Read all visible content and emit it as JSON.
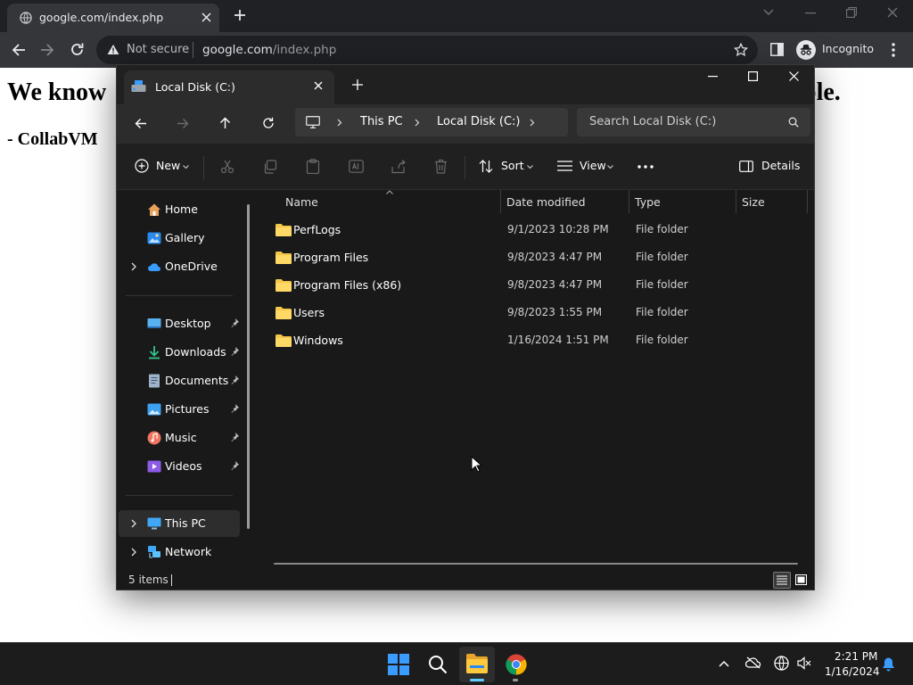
{
  "browser": {
    "tab_title": "google.com/index.php",
    "security_label": "Not secure",
    "url_host": "google.com",
    "url_path": "/index.php",
    "profile_label": "Incognito"
  },
  "page": {
    "heading_left": "We know",
    "heading_right": "ble.",
    "subheading": "- CollabVM"
  },
  "explorer": {
    "tab_title": "Local Disk (C:)",
    "breadcrumb": [
      "This PC",
      "Local Disk (C:)"
    ],
    "search_placeholder": "Search Local Disk (C:)",
    "toolbar": {
      "new_label": "New",
      "sort_label": "Sort",
      "view_label": "View",
      "details_label": "Details"
    },
    "nav": [
      {
        "label": "Home"
      },
      {
        "label": "Gallery"
      },
      {
        "label": "OneDrive"
      },
      {
        "label": "Desktop"
      },
      {
        "label": "Downloads"
      },
      {
        "label": "Documents"
      },
      {
        "label": "Pictures"
      },
      {
        "label": "Music"
      },
      {
        "label": "Videos"
      },
      {
        "label": "This PC"
      },
      {
        "label": "Network"
      }
    ],
    "columns": [
      "Name",
      "Date modified",
      "Type",
      "Size"
    ],
    "rows": [
      {
        "name": "PerfLogs",
        "date": "9/1/2023 10:28 PM",
        "type": "File folder"
      },
      {
        "name": "Program Files",
        "date": "9/8/2023 4:47 PM",
        "type": "File folder"
      },
      {
        "name": "Program Files (x86)",
        "date": "9/8/2023 4:47 PM",
        "type": "File folder"
      },
      {
        "name": "Users",
        "date": "9/8/2023 1:55 PM",
        "type": "File folder"
      },
      {
        "name": "Windows",
        "date": "1/16/2024 1:51 PM",
        "type": "File folder"
      }
    ],
    "status_text": "5 items"
  },
  "taskbar": {
    "time": "2:21 PM",
    "date": "1/16/2024"
  },
  "colors": {
    "folder": "#f3c74a",
    "accent_blue": "#3b9cff",
    "chrome_bg": "#202124"
  }
}
